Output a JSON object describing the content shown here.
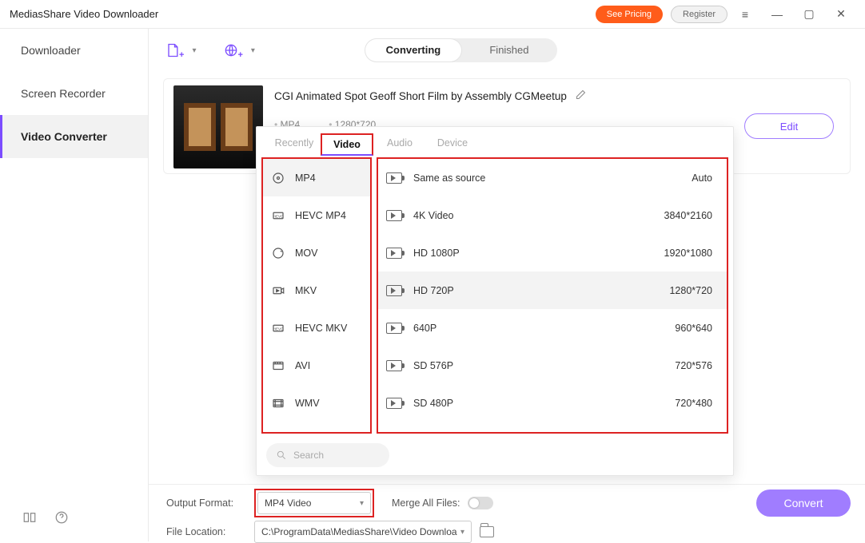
{
  "titlebar": {
    "title": "MediasShare Video Downloader",
    "see_pricing": "See Pricing",
    "register": "Register"
  },
  "sidebar": {
    "items": [
      "Downloader",
      "Screen Recorder",
      "Video Converter"
    ],
    "active_index": 2
  },
  "tabs": {
    "converting": "Converting",
    "finished": "Finished"
  },
  "file": {
    "title": "CGI Animated Spot Geoff Short Film by Assembly  CGMeetup",
    "format": "MP4",
    "resolution": "1280*720",
    "edit": "Edit"
  },
  "popover": {
    "tabs": [
      "Recently",
      "Video",
      "Audio",
      "Device"
    ],
    "active_tab": 1,
    "formats": [
      "MP4",
      "HEVC MP4",
      "MOV",
      "MKV",
      "HEVC MKV",
      "AVI",
      "WMV"
    ],
    "selected_format": 0,
    "resolutions": [
      {
        "name": "Same as source",
        "value": "Auto"
      },
      {
        "name": "4K Video",
        "value": "3840*2160"
      },
      {
        "name": "HD 1080P",
        "value": "1920*1080"
      },
      {
        "name": "HD 720P",
        "value": "1280*720"
      },
      {
        "name": "640P",
        "value": "960*640"
      },
      {
        "name": "SD 576P",
        "value": "720*576"
      },
      {
        "name": "SD 480P",
        "value": "720*480"
      }
    ],
    "selected_res": 3,
    "search_placeholder": "Search"
  },
  "bottom": {
    "output_format_label": "Output Format:",
    "output_format_value": "MP4 Video",
    "merge_label": "Merge All Files:",
    "file_location_label": "File Location:",
    "file_location_value": "C:\\ProgramData\\MediasShare\\Video Downloa",
    "convert": "Convert"
  }
}
